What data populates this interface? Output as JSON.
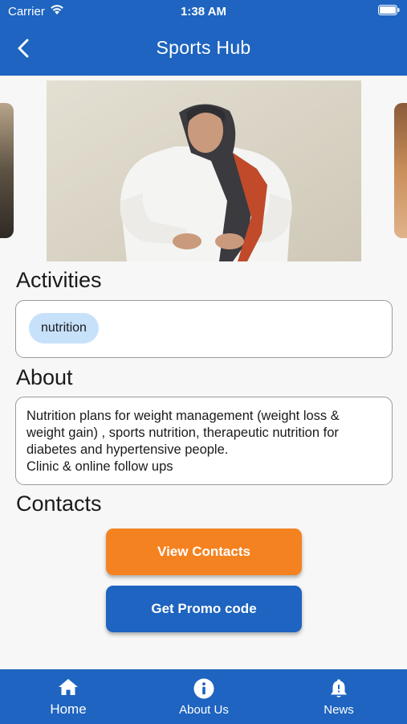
{
  "status_bar": {
    "carrier": "Carrier",
    "time": "1:38 AM"
  },
  "header": {
    "title": "Sports Hub",
    "back_icon": "chevron-left-icon"
  },
  "colors": {
    "primary": "#1e64c0",
    "accent": "#f58220",
    "chip": "#c7e1fb"
  },
  "activities": {
    "title": "Activities",
    "tags": [
      "nutrition"
    ]
  },
  "about": {
    "title": "About",
    "text": "Nutrition plans for weight management (weight loss &\nweight gain) , sports nutrition, therapeutic nutrition for\ndiabetes and hypertensive people.\nClinic & online follow ups"
  },
  "contacts": {
    "title": "Contacts",
    "view_contacts_label": "View Contacts",
    "promo_label": "Get Promo code"
  },
  "bottom_nav": {
    "items": [
      {
        "label": "Home",
        "icon": "home-icon"
      },
      {
        "label": "About Us",
        "icon": "info-icon"
      },
      {
        "label": "News",
        "icon": "bell-icon"
      }
    ]
  }
}
